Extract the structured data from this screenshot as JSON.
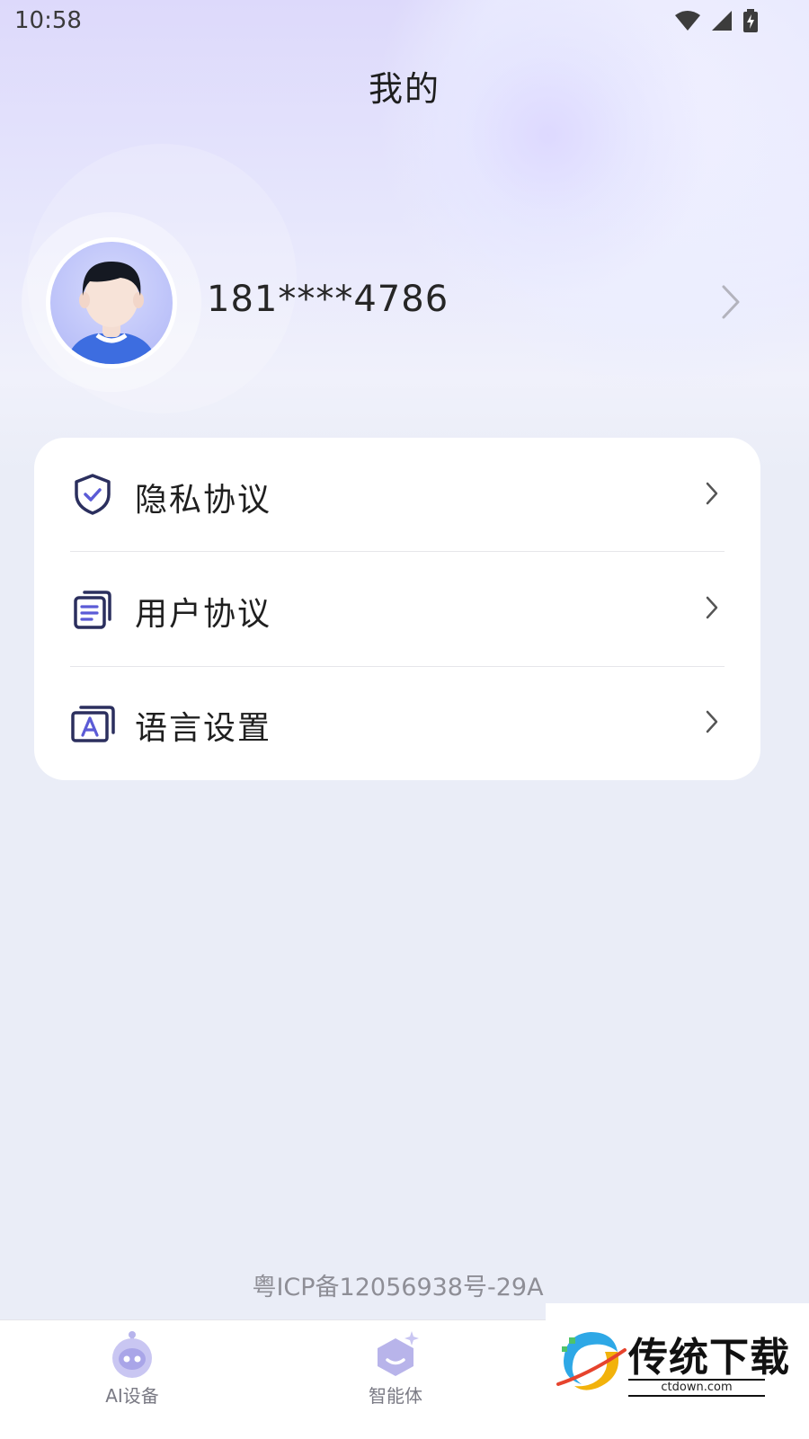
{
  "status_bar": {
    "time": "10:58"
  },
  "header": {
    "title": "我的"
  },
  "profile": {
    "phone": "181****4786"
  },
  "menu": [
    {
      "label": "隐私协议",
      "icon": "shield-check-icon"
    },
    {
      "label": "用户协议",
      "icon": "document-icon"
    },
    {
      "label": "语言设置",
      "icon": "language-icon"
    }
  ],
  "footer": {
    "icp": "粤ICP备12056938号-29A"
  },
  "tabs": [
    {
      "label": "AI设备",
      "icon": "robot-icon"
    },
    {
      "label": "智能体",
      "icon": "agent-icon"
    }
  ],
  "watermark": {
    "brand": "传统下载",
    "domain": "ctdown.com"
  },
  "colors": {
    "accent": "#5b5bd6",
    "icon_dark": "#2b2f5e",
    "background": "#eaedf7"
  }
}
